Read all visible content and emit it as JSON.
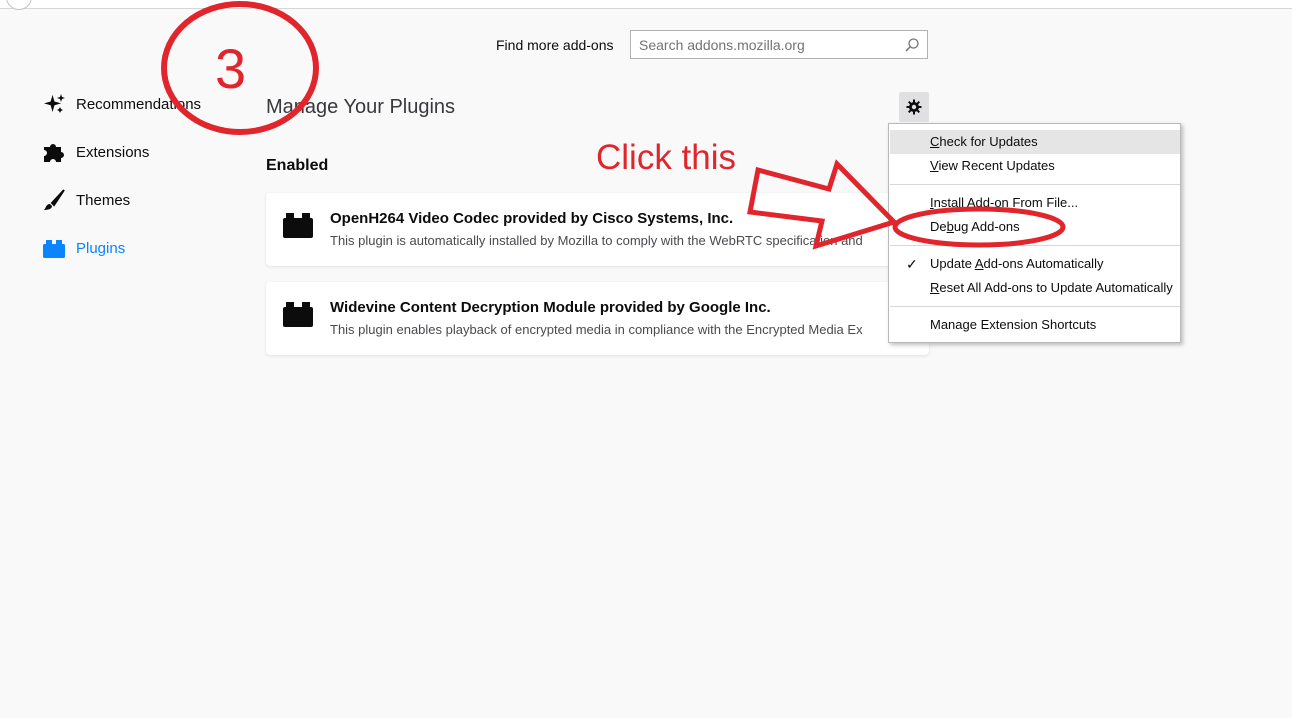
{
  "search": {
    "label": "Find more add-ons",
    "placeholder": "Search addons.mozilla.org",
    "value": ""
  },
  "sidebar": {
    "items": [
      {
        "label": "Recommendations",
        "icon": "sparkle-icon",
        "selected": false
      },
      {
        "label": "Extensions",
        "icon": "puzzle-icon",
        "selected": false
      },
      {
        "label": "Themes",
        "icon": "brush-icon",
        "selected": false
      },
      {
        "label": "Plugins",
        "icon": "plugin-icon",
        "selected": true
      }
    ]
  },
  "main": {
    "title": "Manage Your Plugins",
    "section_heading": "Enabled",
    "plugins": [
      {
        "name": "OpenH264 Video Codec provided by Cisco Systems, Inc.",
        "description": "This plugin is automatically installed by Mozilla to comply with the WebRTC specification and"
      },
      {
        "name": "Widevine Content Decryption Module provided by Google Inc.",
        "description": "This plugin enables playback of encrypted media in compliance with the Encrypted Media Ex"
      }
    ]
  },
  "menu": {
    "items": {
      "check_updates": {
        "mnemonic": "C",
        "rest": "heck for Updates"
      },
      "view_recent": {
        "mnemonic": "V",
        "rest": "iew Recent Updates"
      },
      "install_file": {
        "mnemonic": "I",
        "rest": "nstall Add-on From File..."
      },
      "debug": {
        "pre": "De",
        "mnemonic": "b",
        "rest": "ug Add-ons"
      },
      "update_auto": {
        "pre": "Update ",
        "mnemonic": "A",
        "rest": "dd-ons Automatically",
        "checked": true,
        "check_glyph": "✓"
      },
      "reset_auto": {
        "mnemonic": "R",
        "rest": "eset All Add-ons to Update Automatically"
      },
      "manage_shortcuts": {
        "label": "Manage Extension Shortcuts"
      }
    }
  },
  "annotations": {
    "step_number": "3",
    "instruction": "Click this",
    "color": "#e0262c"
  },
  "colors": {
    "accent": "#0a84ff",
    "background": "#f9f9fa",
    "annotation": "#e0262c"
  }
}
